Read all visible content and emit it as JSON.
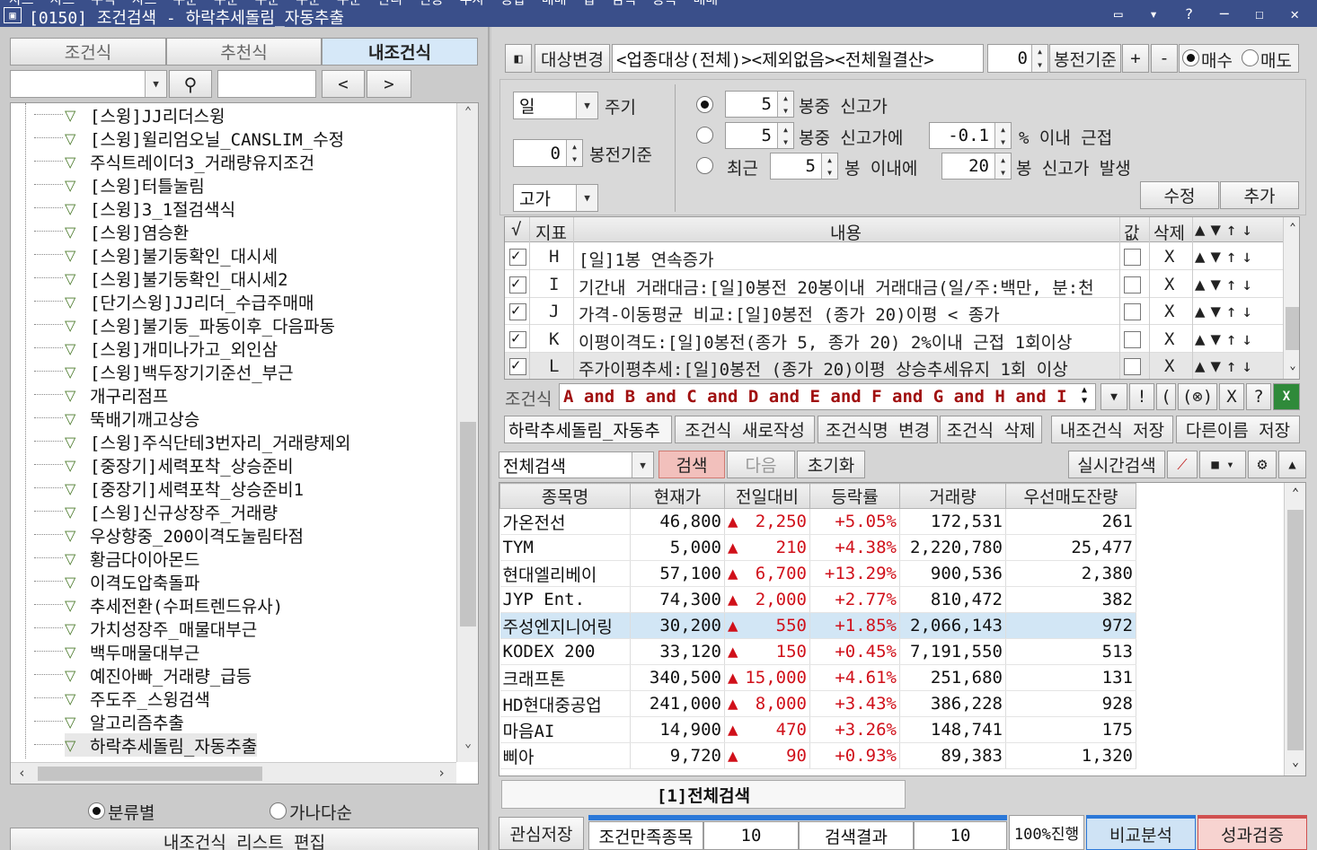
{
  "window": {
    "title": "[0150] 조건검색 - 하락추세돌림_자동추출",
    "top_menus": [
      "차트",
      "차트",
      "주식",
      "차트",
      "주문",
      "주문",
      "주문",
      "주문",
      "주문",
      "관리",
      "연동",
      "투자",
      "종합",
      "매매",
      "업",
      "검색",
      "종목",
      "매매"
    ]
  },
  "left": {
    "tabs": [
      "조건식",
      "추천식",
      "내조건식"
    ],
    "nav_prev": "<",
    "nav_next": ">",
    "tree_items": [
      "[스윙]JJ리더스윙",
      "[스윙]윌리엄오닐_CANSLIM_수정",
      "주식트레이더3_거래량유지조건",
      "[스윙]터틀눌림",
      "[스윙]3_1절검색식",
      "[스윙]염승환",
      "[스윙]불기둥확인_대시세",
      "[스윙]불기둥확인_대시세2",
      "[단기스윙]JJ리더_수급주매매",
      "[스윙]불기둥_파동이후_다음파동",
      "[스윙]개미나가고_외인삼",
      "[스윙]백두장기기준선_부근",
      "개구리점프",
      "뚝배기깨고상승",
      "[스윙]주식단테3번자리_거래량제외",
      "[중장기]세력포착_상승준비",
      "[중장기]세력포착_상승준비1",
      "[스윙]신규상장주_거래량",
      "우상향중_200이격도눌림타점",
      "황금다이아몬드",
      "이격도압축돌파",
      "추세전환(수퍼트렌드유사)",
      "가치성장주_매물대부근",
      "백두매물대부근",
      "예진아빠_거래량_급등",
      "주도주_스윙검색",
      "알고리즘추출",
      "하락추세돌림_자동추출"
    ],
    "sort_options": [
      "분류별",
      "가나다순"
    ],
    "edit_button": "내조건식 리스트 편집"
  },
  "top": {
    "target_change": "대상변경",
    "target_text": "<업종대상(전체)><제외없음><전체월결산>",
    "bong_value": "0",
    "bong_label": "봉전기준",
    "plus": "+",
    "minus": "-",
    "buy": "매수",
    "sell": "매도"
  },
  "settings": {
    "period_value": "일",
    "period_label": "주기",
    "bong_base_value": "0",
    "bong_base_label": "봉전기준",
    "price_value": "고가",
    "opt1_n": "5",
    "opt1_label": "봉중 신고가",
    "opt2_n": "5",
    "opt2_label": "봉중 신고가에",
    "opt2_pct": "-0.1",
    "opt2_suffix": "% 이내 근접",
    "opt3_prefix": "최근",
    "opt3_n": "5",
    "opt3_mid": "봉 이내에",
    "opt3_n2": "20",
    "opt3_suffix": "봉 신고가 발생",
    "edit": "수정",
    "add": "추가"
  },
  "grid": {
    "headers": {
      "check": "√",
      "idx": "지표",
      "content": "내용",
      "val": "값",
      "del": "삭제"
    },
    "rows": [
      {
        "id": "H",
        "text": "[일]1봉 연속증가",
        "del": "X"
      },
      {
        "id": "I",
        "text": "기간내 거래대금:[일]0봉전 20봉이내 거래대금(일/주:백만, 분:천",
        "del": "X"
      },
      {
        "id": "J",
        "text": "가격-이동평균 비교:[일]0봉전 (종가 20)이평 < 종가",
        "del": "X"
      },
      {
        "id": "K",
        "text": "이평이격도:[일]0봉전(종가 5, 종가 20) 2%이내 근접 1회이상",
        "del": "X"
      },
      {
        "id": "L",
        "text": "주가이평추세:[일]0봉전 (종가 20)이평 상승추세유지 1회 이상",
        "del": "X"
      }
    ]
  },
  "formula": {
    "label": "조건식",
    "text": "A and B and C and D and E and F and G and H and I",
    "tools": [
      "!",
      "(",
      ")",
      "(⊗)",
      "X",
      "?"
    ]
  },
  "name_bar": {
    "name": "하락추세돌림_자동추",
    "new": "조건식 새로작성",
    "rename": "조건식명 변경",
    "delete": "조건식 삭제",
    "save": "내조건식 저장",
    "save_as": "다른이름 저장"
  },
  "search_bar": {
    "scope": "전체검색",
    "search": "검색",
    "next": "다음",
    "reset": "초기화",
    "realtime": "실시간검색"
  },
  "results": {
    "headers": [
      "종목명",
      "현재가",
      "전일대비",
      "등락률",
      "거래량",
      "우선매도잔량"
    ],
    "rows": [
      {
        "name": "가온전선",
        "price": "46,800",
        "chg": "2,250",
        "rate": "+5.05%",
        "vol": "172,531",
        "ask": "261"
      },
      {
        "name": "TYM",
        "price": "5,000",
        "chg": "210",
        "rate": "+4.38%",
        "vol": "2,220,780",
        "ask": "25,477"
      },
      {
        "name": "현대엘리베이",
        "price": "57,100",
        "chg": "6,700",
        "rate": "+13.29%",
        "vol": "900,536",
        "ask": "2,380"
      },
      {
        "name": "JYP Ent.",
        "price": "74,300",
        "chg": "2,000",
        "rate": "+2.77%",
        "vol": "810,472",
        "ask": "382"
      },
      {
        "name": "주성엔지니어링",
        "price": "30,200",
        "chg": "550",
        "rate": "+1.85%",
        "vol": "2,066,143",
        "ask": "972"
      },
      {
        "name": "KODEX 200",
        "price": "33,120",
        "chg": "150",
        "rate": "+0.45%",
        "vol": "7,191,550",
        "ask": "513"
      },
      {
        "name": "크래프톤",
        "price": "340,500",
        "chg": "15,000",
        "rate": "+4.61%",
        "vol": "251,680",
        "ask": "131"
      },
      {
        "name": "HD현대중공업",
        "price": "241,000",
        "chg": "8,000",
        "rate": "+3.43%",
        "vol": "386,228",
        "ask": "928"
      },
      {
        "name": "마음AI",
        "price": "14,900",
        "chg": "470",
        "rate": "+3.26%",
        "vol": "148,741",
        "ask": "175"
      },
      {
        "name": "삐아",
        "price": "9,720",
        "chg": "90",
        "rate": "+0.93%",
        "vol": "89,383",
        "ask": "1,320"
      }
    ],
    "up_arrow": "▲",
    "tab": "[1]전체검색"
  },
  "bottom": {
    "save_interest": "관심저장",
    "satisfy_label": "조건만족종목",
    "satisfy_count": "10",
    "result_label": "검색결과",
    "result_count": "10",
    "progress_text": "100%진행",
    "progress": 1.0,
    "compare": "비교분석",
    "verify": "성과검증"
  },
  "colors": {
    "title_bar": "#3a4f8a",
    "selected_row": "#d2e6f5",
    "up": "#d0101a",
    "active_tab": "#d6e8f8",
    "search_btn": "#f2c0bc"
  }
}
